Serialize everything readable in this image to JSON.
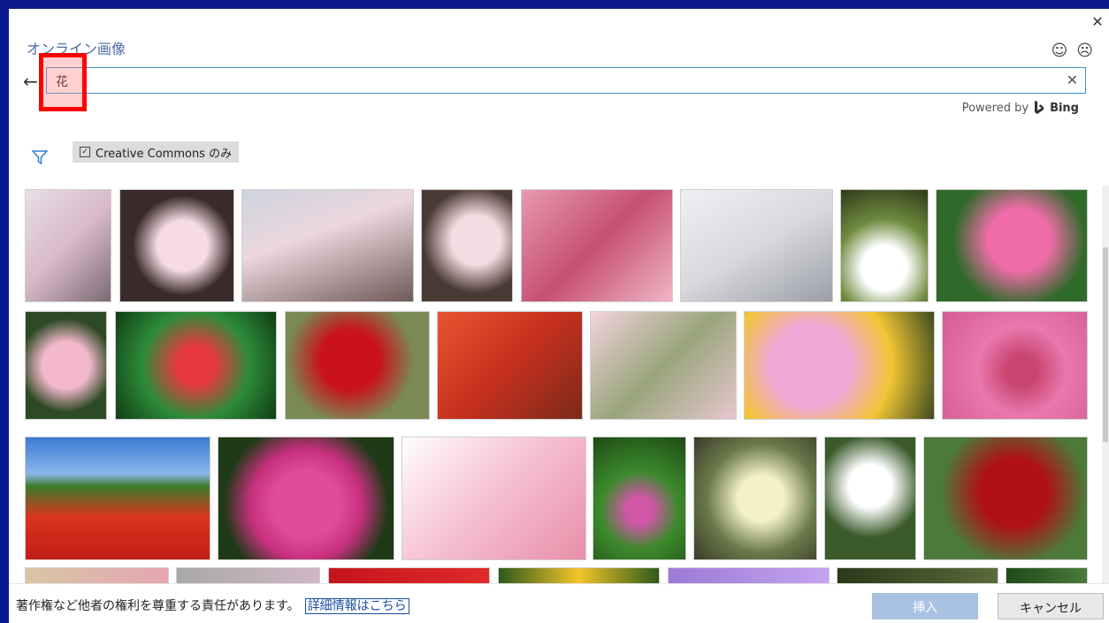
{
  "dialog": {
    "title": "オンライン画像",
    "close_icon": "close-icon",
    "feedback": {
      "smile": "☺",
      "frown": "☹"
    }
  },
  "search": {
    "back_icon": "back-arrow-icon",
    "query": "花",
    "clear_icon": "clear-icon"
  },
  "powered_by": {
    "label": "Powered by",
    "brand": "Bing"
  },
  "filter": {
    "icon": "filter-icon",
    "creative_commons_label": "Creative Commons のみ",
    "creative_commons_checked": true
  },
  "results": {
    "rows": [
      {
        "items": [
          "sakura-1",
          "sakura-2",
          "sakura-3",
          "sakura-4",
          "plum-pink",
          "sakura-white",
          "white-bract",
          "azalea"
        ]
      },
      {
        "items": [
          "pink-rose",
          "red-spider-lily",
          "red-anemone",
          "quince",
          "small-pink",
          "cosmos",
          "pink-hibiscus"
        ]
      },
      {
        "items": [
          "poppy-field",
          "dahlia",
          "cherry-blossom",
          "geranium",
          "yellow-flower",
          "white-flower",
          "red-carnation"
        ]
      },
      {
        "items": [
          "flower-a",
          "flower-b",
          "flower-c",
          "flower-d",
          "flower-e",
          "flower-f",
          "flower-g"
        ]
      }
    ]
  },
  "footer": {
    "notice": "著作権など他者の権利を尊重する責任があります。",
    "more_link": "詳細情報はこちら",
    "insert_label": "挿入",
    "cancel_label": "キャンセル"
  },
  "colors": {
    "accent": "#3a8fd6",
    "title": "#4a6aa8",
    "insert_disabled": "#a9c2e3",
    "highlight": "#ff0000"
  }
}
